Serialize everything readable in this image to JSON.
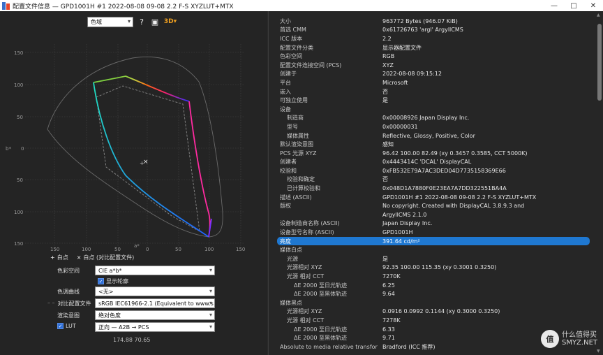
{
  "window": {
    "title": "配置文件信息 — GPD1001H #1 2022-08-08 09-08 2.2 F-S XYZLUT+MTX",
    "min_glyph": "—",
    "max_glyph": "□",
    "close_glyph": "✕"
  },
  "toolbar": {
    "plot_select": "色域",
    "help_glyph": "?",
    "image_glyph": "▣",
    "warm_glyph": "3D▾"
  },
  "plot": {
    "x_ticks": [
      "150",
      "100",
      "50",
      "0",
      "50",
      "100",
      "150"
    ],
    "y_ticks": [
      "150",
      "100",
      "50",
      "0",
      "50",
      "100",
      "150"
    ],
    "xlabel": "a*",
    "ylabel": "b*",
    "marker": "×"
  },
  "legend": {
    "whitepoint_marker": "+",
    "whitepoint_label": "白点",
    "ref_marker": "×",
    "ref_label": "白点 (对比配置文件)"
  },
  "form": {
    "colorspace_label": "色彩空间",
    "colorspace_value": "CIE a*b*",
    "show_outline_label": "显示轮廓",
    "show_outline_check": "✓",
    "tone_curve_label": "色调曲线",
    "tone_curve_value": "<无>",
    "compare_label": "对比配置文件",
    "compare_value": "sRGB IEC61966-2.1 (Equivalent to www.s",
    "intent_label": "渲染意图",
    "intent_value": "绝对色度",
    "lut_check": "✓",
    "lut_label": "LUT",
    "lut_value": "正向 — A2B → PCS",
    "coords": "174.88 70.65"
  },
  "info_rows": [
    {
      "k": "大小",
      "v": "963772 Bytes (946.07 KiB)",
      "indent": 0
    },
    {
      "k": "首选 CMM",
      "v": "0x61726763 'argl' ArgyllCMS",
      "indent": 0
    },
    {
      "k": "ICC 版本",
      "v": "2.2",
      "indent": 0
    },
    {
      "k": "配置文件分类",
      "v": "显示器配置文件",
      "indent": 0
    },
    {
      "k": "色彩空间",
      "v": "RGB",
      "indent": 0
    },
    {
      "k": "配置文件连接空间 (PCS)",
      "v": "XYZ",
      "indent": 0
    },
    {
      "k": "创建于",
      "v": "2022-08-08 09:15:12",
      "indent": 0
    },
    {
      "k": "平台",
      "v": "Microsoft",
      "indent": 0
    },
    {
      "k": "嵌入",
      "v": "否",
      "indent": 0
    },
    {
      "k": "可独立使用",
      "v": "是",
      "indent": 0
    },
    {
      "k": "设备",
      "v": "",
      "indent": 0
    },
    {
      "k": "制造商",
      "v": "0x00008926 Japan Display Inc.",
      "indent": 1
    },
    {
      "k": "型号",
      "v": "0x00000031",
      "indent": 1
    },
    {
      "k": "媒体属性",
      "v": "Reflective, Glossy, Positive, Color",
      "indent": 1
    },
    {
      "k": "默认渲染意图",
      "v": "感知",
      "indent": 0
    },
    {
      "k": "PCS 光源 XYZ",
      "v": "96.42 100.00 82.49 (xy 0.3457 0.3585, CCT 5000K)",
      "indent": 0
    },
    {
      "k": "创建者",
      "v": "0x4443414C 'DCAL' DisplayCAL",
      "indent": 0
    },
    {
      "k": "校验和",
      "v": "0xFB532E79A7AC3DED04D7735158369E66",
      "indent": 0
    },
    {
      "k": "校验和确定",
      "v": "否",
      "indent": 1
    },
    {
      "k": "已计算校验和",
      "v": "0x048D1A7880F0E23EA7A7DD322551BA4A",
      "indent": 1
    },
    {
      "k": "描述 (ASCII)",
      "v": "GPD1001H #1 2022-08-08 09-08 2.2 F-S XYZLUT+MTX",
      "indent": 0
    },
    {
      "k": "版权",
      "v": "No copyright. Created with DisplayCAL 3.8.9.3 and",
      "indent": 0
    },
    {
      "k": "",
      "v": "ArgyllCMS 2.1.0",
      "indent": 0
    },
    {
      "k": "设备制造商名称 (ASCII)",
      "v": "Japan Display Inc.",
      "indent": 0
    },
    {
      "k": "设备型号名称 (ASCII)",
      "v": "GPD1001H",
      "indent": 0
    },
    {
      "k": "亮度",
      "v": "391.64 cd/m²",
      "indent": 0,
      "selected": true
    },
    {
      "k": "媒体白点",
      "v": "",
      "indent": 0
    },
    {
      "k": "光源",
      "v": "是",
      "indent": 1
    },
    {
      "k": "光源相对 XYZ",
      "v": "92.35 100.00 115.35 (xy 0.3001 0.3250)",
      "indent": 1
    },
    {
      "k": "光源 相对 CCT",
      "v": "7270K",
      "indent": 1
    },
    {
      "k": "ΔE 2000 至日光轨迹",
      "v": "6.25",
      "indent": 2
    },
    {
      "k": "ΔE 2000 至黑体轨迹",
      "v": "9.64",
      "indent": 2
    },
    {
      "k": "媒体黑点",
      "v": "",
      "indent": 0
    },
    {
      "k": "光源相对 XYZ",
      "v": "0.0916 0.0992 0.1144 (xy 0.3000 0.3250)",
      "indent": 1
    },
    {
      "k": "光源 相对 CCT",
      "v": "7278K",
      "indent": 1
    },
    {
      "k": "ΔE 2000 至日光轨迹",
      "v": "6.33",
      "indent": 2
    },
    {
      "k": "ΔE 2000 至黑体轨迹",
      "v": "9.71",
      "indent": 2
    },
    {
      "k": "Absolute to media relative transform",
      "v": "Bradford (ICC 推荐)",
      "indent": 0
    }
  ],
  "watermark": {
    "badge": "值",
    "line1": "什么值得买",
    "line2": "SMYZ.NET"
  }
}
